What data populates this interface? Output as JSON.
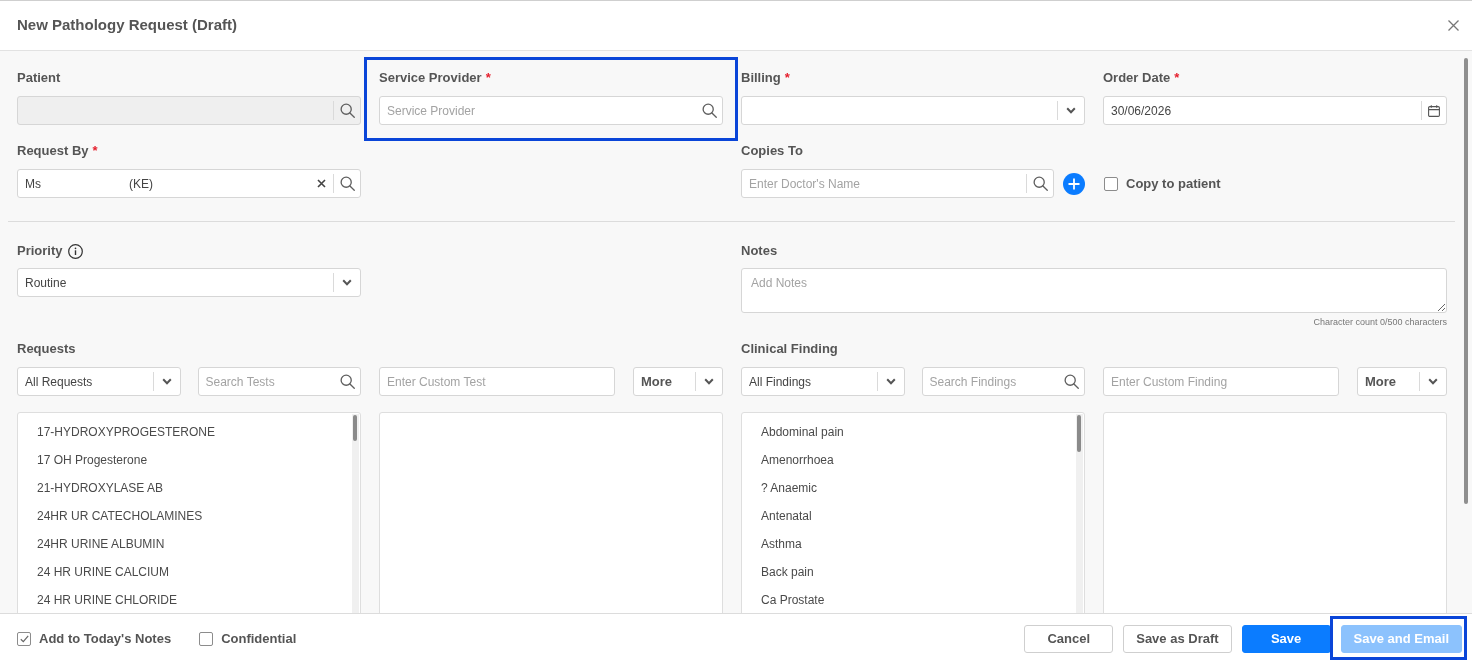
{
  "dialog": {
    "title": "New Pathology Request (Draft)"
  },
  "patient": {
    "label": "Patient",
    "disabled": true
  },
  "service_provider": {
    "label": "Service Provider",
    "required_mark": "*",
    "placeholder": "Service Provider",
    "highlighted": true
  },
  "billing": {
    "label": "Billing",
    "required_mark": "*"
  },
  "order_date": {
    "label": "Order Date",
    "required_mark": "*",
    "value": "30/06/2026"
  },
  "request_by": {
    "label": "Request By",
    "required_mark": "*",
    "value_parts": [
      "Ms",
      "(KE)"
    ]
  },
  "copies_to": {
    "label": "Copies To",
    "placeholder": "Enter Doctor's Name"
  },
  "copy_to_patient": {
    "label": "Copy to patient",
    "checked": false
  },
  "priority": {
    "label": "Priority",
    "value": "Routine"
  },
  "notes": {
    "label": "Notes",
    "placeholder": "Add Notes",
    "character_count": "Character count 0/500 characters"
  },
  "requests": {
    "label": "Requests",
    "filter": "All Requests",
    "search_placeholder": "Search Tests",
    "custom_placeholder": "Enter Custom Test",
    "more": "More",
    "items": [
      "17-HYDROXYPROGESTERONE",
      "17 OH Progesterone",
      "21-HYDROXYLASE AB",
      "24HR UR CATECHOLAMINES",
      "24HR URINE ALBUMIN",
      "24 HR URINE CALCIUM",
      "24 HR URINE CHLORIDE"
    ]
  },
  "clinical_finding": {
    "label": "Clinical Finding",
    "filter": "All Findings",
    "search_placeholder": "Search Findings",
    "custom_placeholder": "Enter Custom Finding",
    "more": "More",
    "items": [
      "Abdominal pain",
      "Amenorrhoea",
      "? Anaemic",
      "Antenatal",
      "Asthma",
      "Back pain",
      "Ca Prostate"
    ]
  },
  "footer": {
    "options": [
      {
        "label": "Add to Today's Notes",
        "checked": true
      },
      {
        "label": "Confidential",
        "checked": false
      }
    ],
    "buttons": [
      {
        "label": "Cancel",
        "kind": "secondary",
        "disabled": false,
        "highlighted": false
      },
      {
        "label": "Save as Draft",
        "kind": "secondary",
        "disabled": false,
        "highlighted": false
      },
      {
        "label": "Save",
        "kind": "primary",
        "disabled": false,
        "highlighted": false
      },
      {
        "label": "Save and Email",
        "kind": "primary",
        "disabled": true,
        "highlighted": true
      }
    ]
  }
}
